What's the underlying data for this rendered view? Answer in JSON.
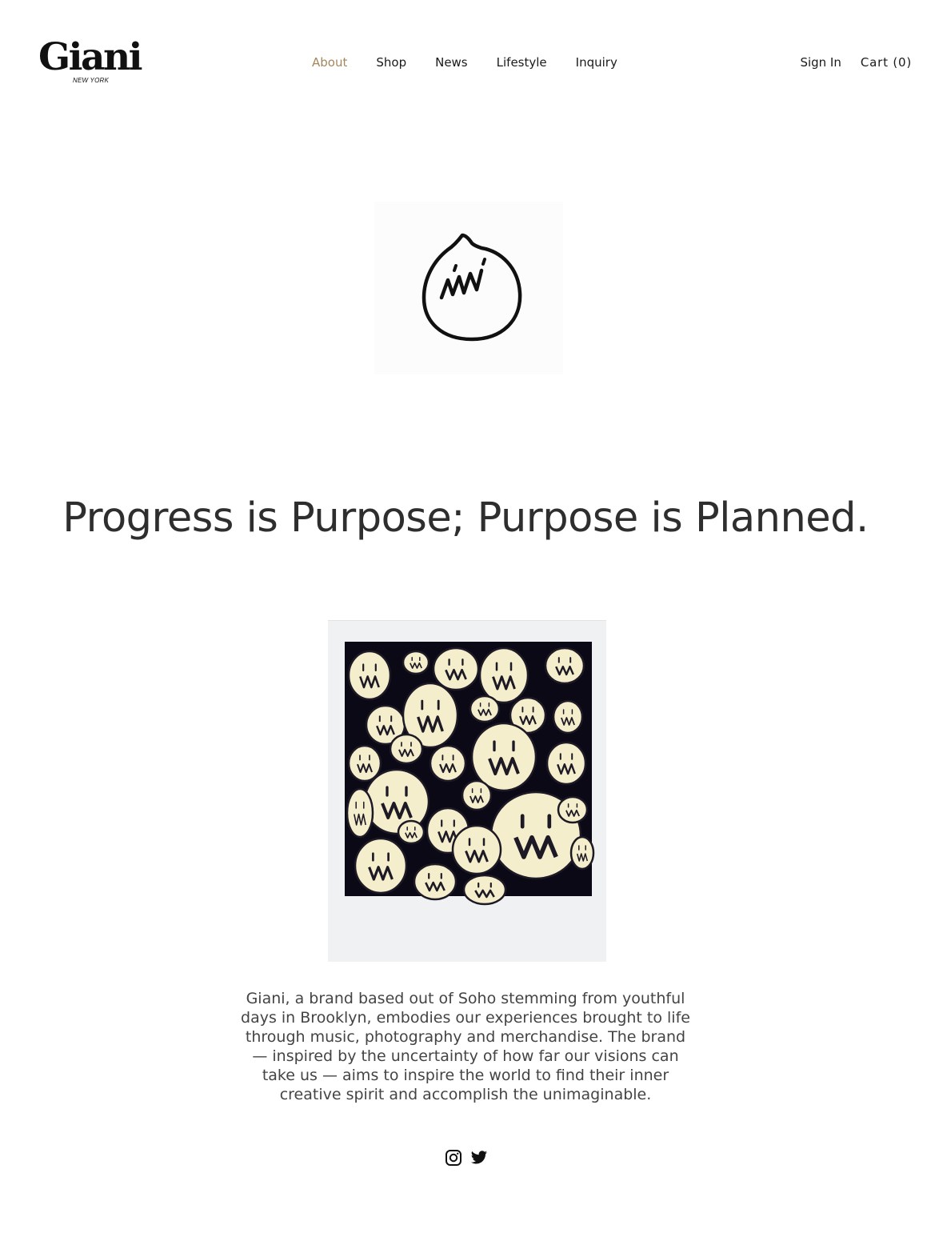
{
  "brand": {
    "name": "Giani",
    "subtitle": "NEW YORK"
  },
  "nav": {
    "items": [
      {
        "label": "About",
        "active": true
      },
      {
        "label": "Shop",
        "active": false
      },
      {
        "label": "News",
        "active": false
      },
      {
        "label": "Lifestyle",
        "active": false
      },
      {
        "label": "Inquiry",
        "active": false
      }
    ],
    "active_color": "#a3875c"
  },
  "account": {
    "sign_in": "Sign In",
    "cart": "Cart (0)"
  },
  "hero": {
    "headline": "Progress is Purpose; Purpose is Planned."
  },
  "about": {
    "description": "Giani, a brand based out of Soho stemming from youthful days in Brooklyn, embodies our experiences brought to life through music, photography and merchandise. The brand — inspired by the uncertainty of how far our visions can take us — aims to inspire the world to find their inner creative spirit and accomplish the unimaginable."
  },
  "social": {
    "icons": [
      "instagram-icon",
      "twitter-icon"
    ]
  }
}
